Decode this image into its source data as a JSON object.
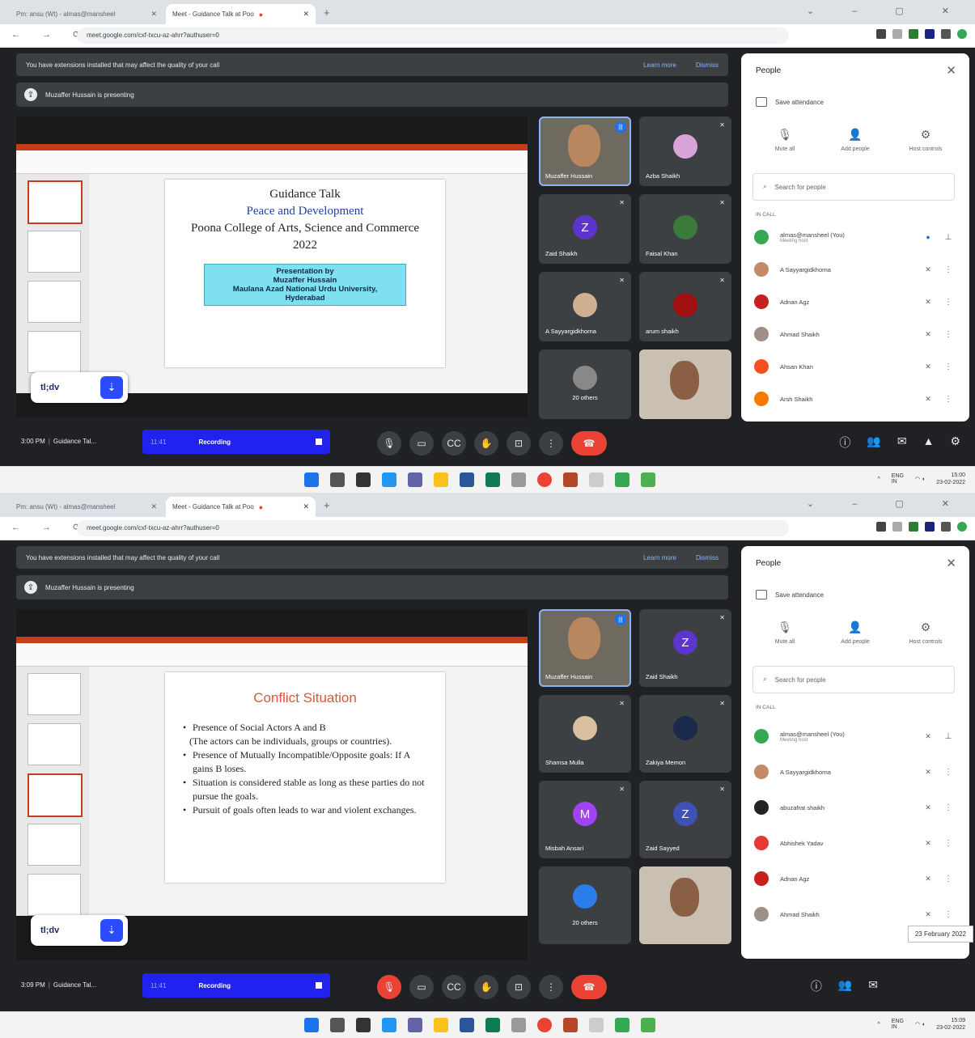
{
  "browser": {
    "tab_inactive": "Pm: ansu (Wt) - almas@mansheel",
    "tab_active": "Meet - Guidance Talk at Poo",
    "url": "meet.google.com/cxf-txcu-az-ahrr?authuser=0"
  },
  "banner": {
    "text": "You have extensions installed that may affect the quality of your call",
    "learn": "Learn more",
    "dismiss": "Dismiss"
  },
  "presenting": "Muzaffer Hussain is presenting",
  "slide1": {
    "lines": [
      "Guidance Talk",
      "Peace and Development",
      "Poona College of  Arts, Science and Commerce",
      "2022"
    ],
    "box": [
      "Presentation by",
      "Muzaffer Hussain",
      "Maulana Azad National Urdu University,",
      "Hyderabad"
    ]
  },
  "slide2": {
    "title": "Conflict Situation",
    "bullets": [
      "Presence of Social Actors  A and B",
      "(The actors can be individuals, groups or countries).",
      "Presence of Mutually Incompatible/Opposite goals: If A gains B loses.",
      "Situation is considered stable as long as these parties do not pursue the goals.",
      "Pursuit of goals often leads to war and violent exchanges."
    ]
  },
  "tldv": {
    "logo": "tl;dv"
  },
  "tiles1": [
    {
      "name": "Muzaffer Hussain"
    },
    {
      "name": "Azba Shaikh"
    },
    {
      "name": "Zaid Shaikh",
      "initial": "Z"
    },
    {
      "name": "Faisal Khan"
    },
    {
      "name": "A Sayyargidkhorna"
    },
    {
      "name": "arum shaikh"
    },
    {
      "name": "20 others"
    }
  ],
  "tiles2": [
    {
      "name": "Muzaffer Hussain"
    },
    {
      "name": "Zaid Shaikh",
      "initial": "Z"
    },
    {
      "name": "Shamsa Mulla"
    },
    {
      "name": "Zakiya Memon"
    },
    {
      "name": "Misbah Ansari",
      "initial": "M"
    },
    {
      "name": "Zaid Sayyed",
      "initial": "Z"
    },
    {
      "name": "20 others"
    }
  ],
  "panel": {
    "title": "People",
    "attendance": "Save attendance",
    "mute_all": "Mute all",
    "add_people": "Add people",
    "host_controls": "Host controls",
    "search_placeholder": "Search for people",
    "in_call": "IN CALL"
  },
  "people1": [
    {
      "name": "almas@mansheel (You)",
      "sub": "Meeting host",
      "color": "#34a853"
    },
    {
      "name": "A Sayyargidkhorna",
      "color": "#c58a6a"
    },
    {
      "name": "Adnan Agz",
      "color": "#c5221f"
    },
    {
      "name": "Ahmad Shaikh",
      "color": "#9e8f88"
    },
    {
      "name": "Ahsan Khan",
      "color": "#f4511e"
    },
    {
      "name": "Arsh Shaikh",
      "color": "#f57c00"
    }
  ],
  "people2": [
    {
      "name": "almas@mansheel (You)",
      "sub": "Meeting host",
      "color": "#34a853"
    },
    {
      "name": "A Sayyargidkhorna",
      "color": "#c58a6a"
    },
    {
      "name": "abuzafrat shaikh",
      "color": "#222222"
    },
    {
      "name": "Abhishek Yadav",
      "color": "#e53935"
    },
    {
      "name": "Adnan Agz",
      "color": "#c5221f"
    },
    {
      "name": "Ahmad Shaikh",
      "color": "#9e8f88"
    }
  ],
  "controls1": {
    "time": "3:00 PM",
    "meeting": "Guidance Tal...",
    "rec_time": "11:41",
    "recording": "Recording"
  },
  "controls2": {
    "time": "3:09 PM",
    "meeting": "Guidance Tal...",
    "rec_time": "11:41",
    "recording": "Recording"
  },
  "taskbar": {
    "lang1": "ENG",
    "lang2": "IN",
    "time1": "15:00",
    "time2": "15:09",
    "date": "23-02-2022",
    "popup": "23 February 2022"
  }
}
